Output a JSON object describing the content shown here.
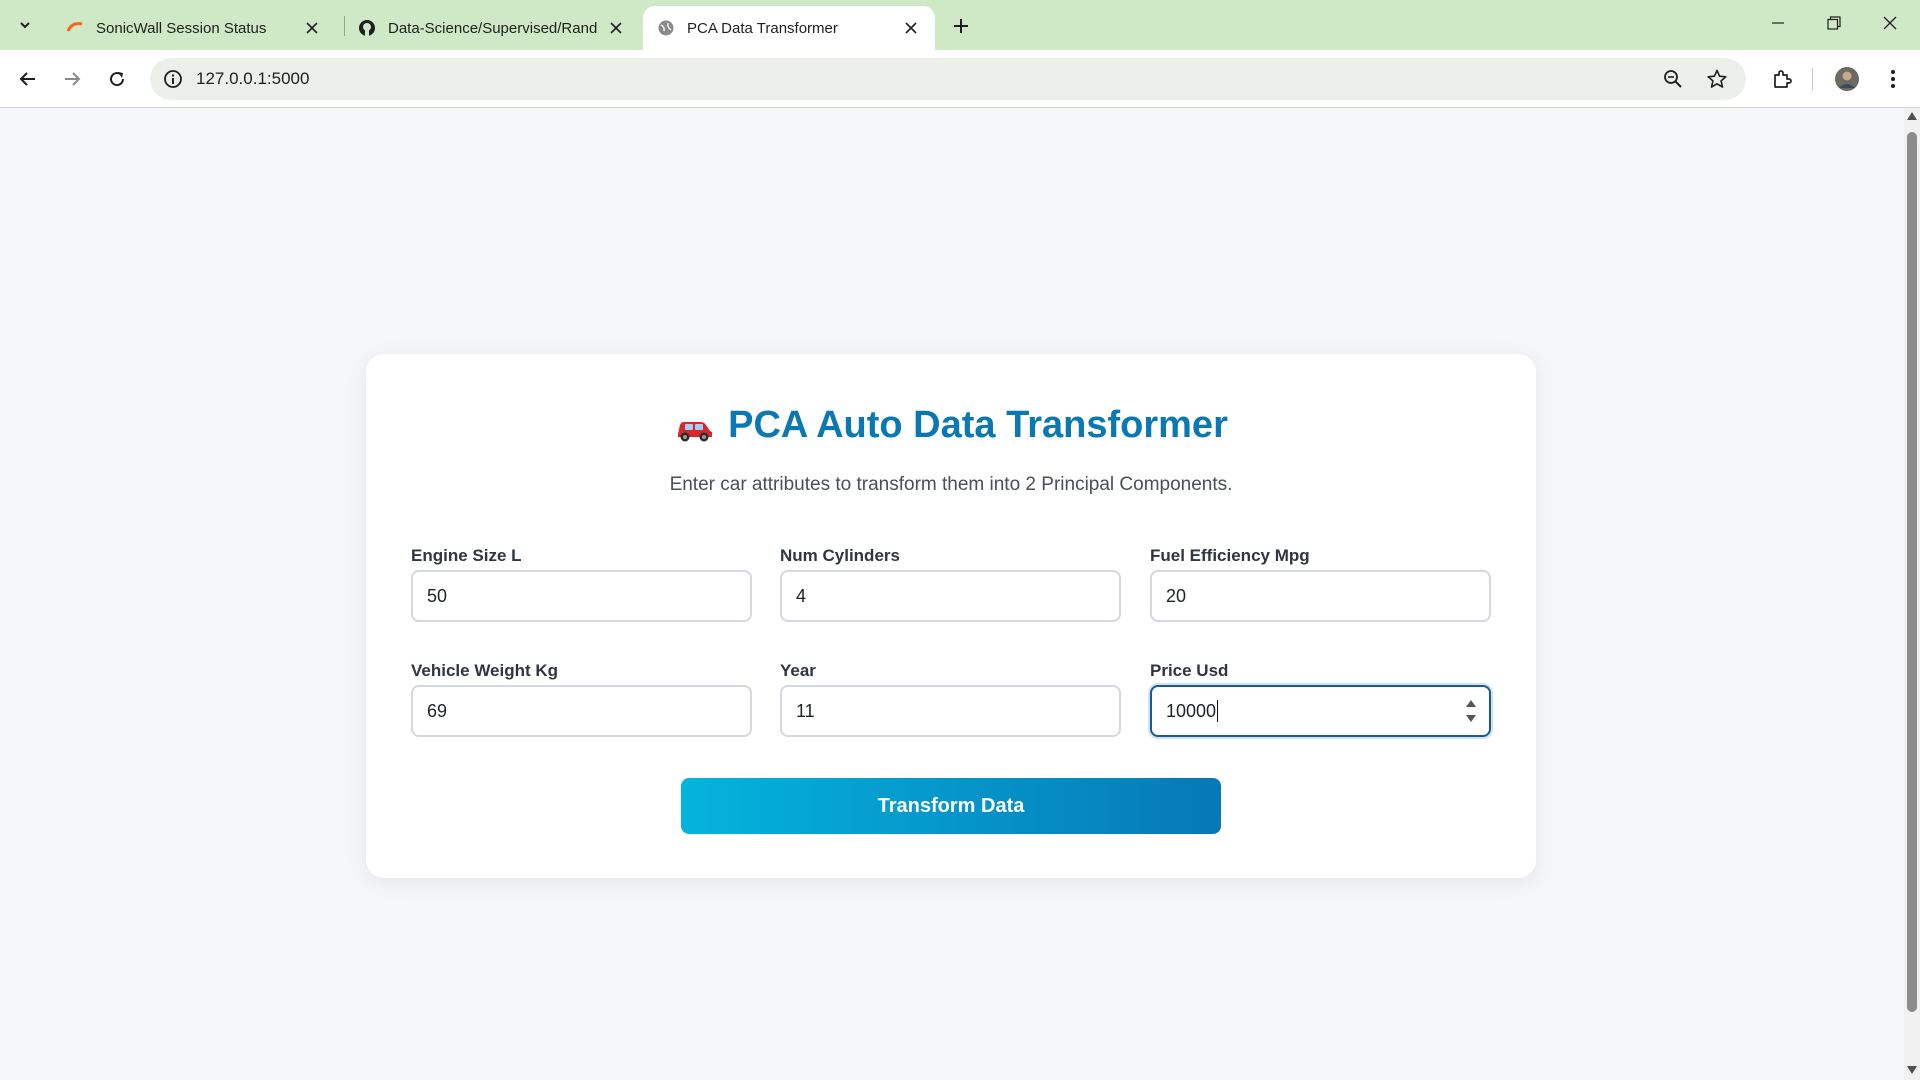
{
  "browser": {
    "tabs": [
      {
        "title": "SonicWall Session Status",
        "active": false
      },
      {
        "title": "Data-Science/Supervised/Rand",
        "active": false
      },
      {
        "title": "PCA Data Transformer",
        "active": true
      }
    ],
    "url": "127.0.0.1:5000"
  },
  "page": {
    "title": "PCA Auto Data Transformer",
    "title_icon": "car-icon",
    "subtitle": "Enter car attributes to transform them into 2 Principal Components.",
    "fields": [
      {
        "label": "Engine Size L",
        "value": "50"
      },
      {
        "label": "Num Cylinders",
        "value": "4"
      },
      {
        "label": "Fuel Efficiency Mpg",
        "value": "20"
      },
      {
        "label": "Vehicle Weight Kg",
        "value": "69"
      },
      {
        "label": "Year",
        "value": "11"
      },
      {
        "label": "Price Usd",
        "value": "10000"
      }
    ],
    "submit_label": "Transform Data"
  },
  "colors": {
    "accent": "#0a78b3",
    "button_start": "#04b4dd",
    "button_end": "#0678b8",
    "tabstrip": "#cfe8c6"
  }
}
